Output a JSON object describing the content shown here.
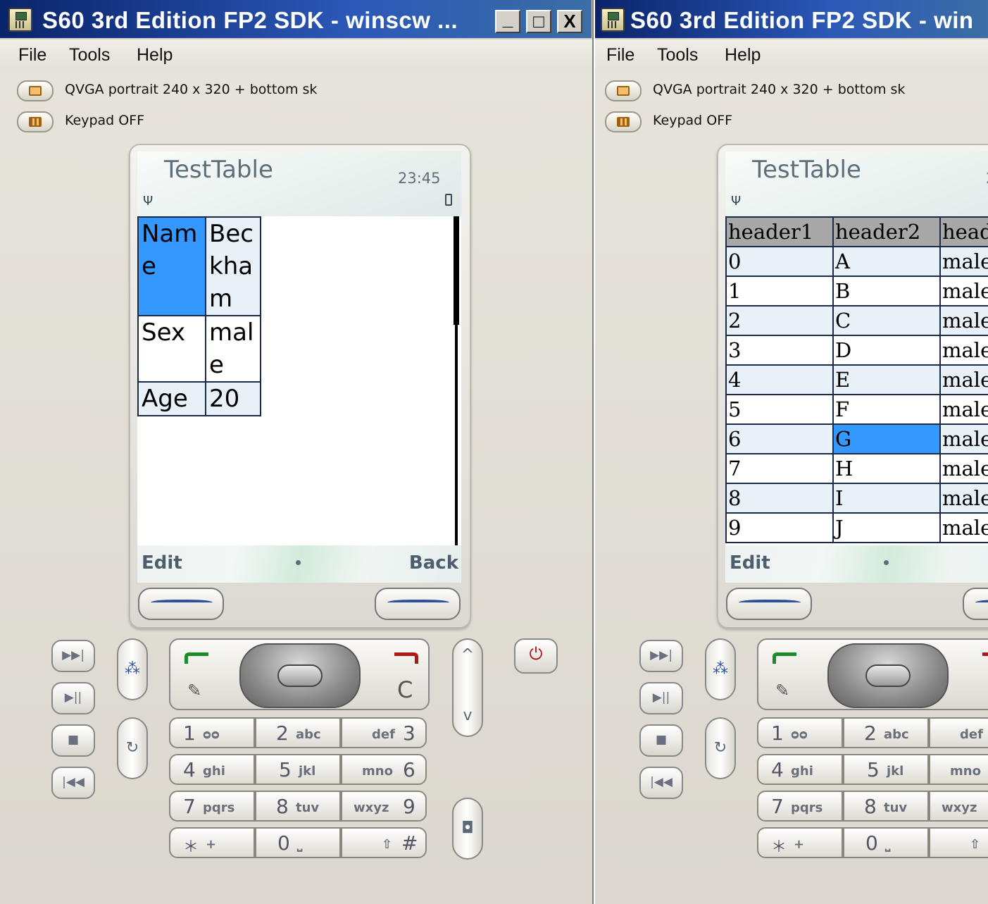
{
  "windows": [
    {
      "title": "S60 3rd Edition FP2 SDK - winscw ...",
      "title_buttons": {
        "minimize": "_",
        "maximize": "□",
        "close": "X"
      },
      "menu": [
        "File",
        "Tools",
        "Help"
      ],
      "resolution_label": "QVGA portrait 240 x 320 + bottom sk",
      "keypad_label": "Keypad OFF",
      "phone": {
        "app_title": "TestTable",
        "time": "23:45",
        "softkeys": {
          "left": "Edit",
          "right": "Back"
        },
        "table_rows": [
          {
            "label_lines": [
              "Nam",
              "e"
            ],
            "value_lines": [
              "Bec",
              "kha",
              "m"
            ],
            "selected": true
          },
          {
            "label_lines": [
              "Sex"
            ],
            "value_lines": [
              "mal",
              "e"
            ],
            "selected": false
          },
          {
            "label_lines": [
              "Age"
            ],
            "value_lines": [
              "20"
            ],
            "selected": false
          }
        ]
      }
    },
    {
      "title": "S60 3rd Edition FP2 SDK - win",
      "menu": [
        "File",
        "Tools",
        "Help"
      ],
      "resolution_label": "QVGA portrait 240 x 320 + bottom sk",
      "keypad_label": "Keypad OFF",
      "phone": {
        "app_title": "TestTable",
        "time_partial": "2",
        "softkeys": {
          "left": "Edit"
        },
        "table_headers": [
          "header1",
          "header2",
          "head"
        ],
        "table_rows": [
          [
            "0",
            "A",
            "male"
          ],
          [
            "1",
            "B",
            "male"
          ],
          [
            "2",
            "C",
            "male"
          ],
          [
            "3",
            "D",
            "male"
          ],
          [
            "4",
            "E",
            "male"
          ],
          [
            "5",
            "F",
            "male"
          ],
          [
            "6",
            "G",
            "male"
          ],
          [
            "7",
            "H",
            "male"
          ],
          [
            "8",
            "I",
            "male"
          ],
          [
            "9",
            "J",
            "male"
          ]
        ],
        "selected_row": 6,
        "selected_col": 1
      }
    }
  ],
  "keypad": {
    "keys": [
      {
        "big": "1",
        "small": "ᴑᴑ"
      },
      {
        "big": "2",
        "small": "abc"
      },
      {
        "small": "def",
        "big": "3"
      },
      {
        "big": "4",
        "small": "ghi"
      },
      {
        "big": "5",
        "small": "jkl"
      },
      {
        "small": "mno",
        "big": "6"
      },
      {
        "big": "7",
        "small": "pqrs"
      },
      {
        "big": "8",
        "small": "tuv"
      },
      {
        "small": "wxyz",
        "big": "9"
      },
      {
        "big": "＊",
        "small": "+"
      },
      {
        "big": "0",
        "small": "⎵"
      },
      {
        "small": "⇧",
        "big": "#"
      }
    ],
    "right_keys_partial": [
      "def",
      "mno",
      "wxyz",
      "⇧"
    ],
    "clear_key": "C"
  },
  "colors": {
    "titlebar": "#0a246a",
    "selection": "#3399ff",
    "row_alt": "#e8f1f8",
    "header_bg": "#a8a8a8",
    "softkey_text": "#4c5e6e"
  },
  "icons": {
    "media_buttons": [
      "fast-forward-icon",
      "play-pause-icon",
      "stop-icon",
      "rewind-icon"
    ],
    "side_keys": [
      "menu-apps-icon",
      "voice-key-icon"
    ],
    "power": "power-icon",
    "camera": "camera-icon"
  }
}
